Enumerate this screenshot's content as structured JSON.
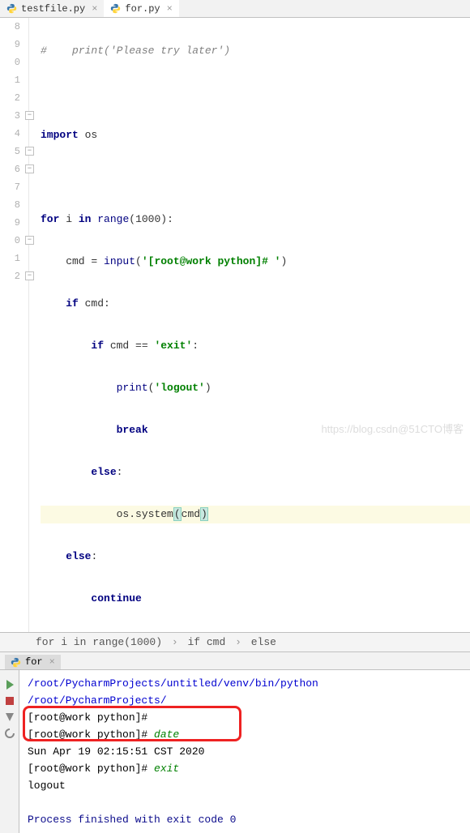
{
  "tabs": [
    {
      "label": "testfile.py",
      "active": false
    },
    {
      "label": "for.py",
      "active": true
    }
  ],
  "gutter": [
    "8",
    "9",
    "0",
    "1",
    "2",
    "3",
    "4",
    "5",
    "6",
    "7",
    "8",
    "9",
    "0",
    "1",
    "2"
  ],
  "code": {
    "l0": {
      "c": "#    ",
      "p": "print",
      "a": "(",
      "s": "'Please try later'",
      "z": ")"
    },
    "l2": {
      "k": "import ",
      "m": "os"
    },
    "l4": {
      "k1": "for ",
      "v": "i ",
      "k2": "in ",
      "f": "range",
      "a": "(",
      "n": "1000",
      "z": "):"
    },
    "l5": {
      "pre": "    cmd = ",
      "f": "input",
      "a": "(",
      "s": "'[root@work python]# '",
      "z": ")"
    },
    "l6": {
      "pre": "    ",
      "k": "if ",
      "v": "cmd:"
    },
    "l7": {
      "pre": "        ",
      "k": "if ",
      "v": "cmd == ",
      "s": "'exit'",
      "z": ":"
    },
    "l8": {
      "pre": "            ",
      "f": "print",
      "a": "(",
      "s": "'logout'",
      "z": ")"
    },
    "l9": {
      "pre": "            ",
      "k": "break"
    },
    "l10": {
      "pre": "        ",
      "k": "else",
      "z": ":"
    },
    "l11": {
      "pre": "            os.system",
      "a": "(",
      "v": "cmd",
      "z": ")"
    },
    "l12": {
      "pre": "    ",
      "k": "else",
      "z": ":"
    },
    "l13": {
      "pre": "        ",
      "k": "continue"
    }
  },
  "breadcrumb": {
    "a": "for i in range(1000)",
    "b": "if cmd",
    "c": "else"
  },
  "runTab": "for",
  "terminal": {
    "path": "/root/PycharmProjects/untitled/venv/bin/python /root/PycharmProjects/",
    "prompt1": "[root@work python]#",
    "prompt2": "[root@work python]# ",
    "cmd1": "date",
    "out1": "Sun Apr 19 02:15:51 CST 2020",
    "cmd2": "exit",
    "out2": "logout",
    "finished": "Process finished with exit code 0"
  },
  "watermark": "https://blog.csdn@51CTO博客"
}
